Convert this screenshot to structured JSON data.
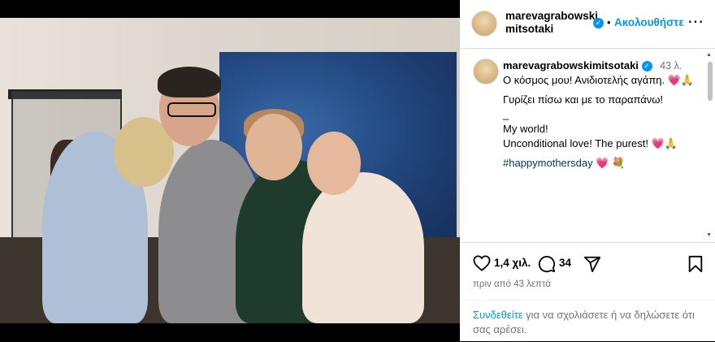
{
  "header": {
    "username": "marevagrabowskimitsotaki",
    "verified_mark": "✓",
    "separator": "•",
    "follow_label": "Ακολουθήστε",
    "more_label": "⋯"
  },
  "caption": {
    "username": "marevagrabowskimitsotaki",
    "verified_mark": "✓",
    "time": "43 λ.",
    "line1": "Ο κόσμος μου! Ανιδιοτελής αγάπη. 💗🙏",
    "line2": "Γυρίζει πίσω και με το παραπάνω!",
    "line3": "_",
    "line4": "My world!",
    "line5": "Unconditional love! The purest! 💗🙏",
    "hashtag": "#happymothersday",
    "hashtag_tail": "💗 💐"
  },
  "load_more_label": "+",
  "actions": {
    "likes": "1,4 χιλ.",
    "comments": "34",
    "posted_time": "πριν από 43 λεπτά"
  },
  "login": {
    "link": "Συνδεθείτε",
    "text": " για να σχολιάσετε ή να δηλώσετε ότι σας αρέσει."
  },
  "icons": {
    "heart": "heart-icon",
    "comment": "comment-icon",
    "share": "share-icon",
    "save": "bookmark-icon",
    "add": "plus-circle-icon",
    "more": "more-icon"
  },
  "colors": {
    "accent": "#0095f6",
    "secondary_text": "#737373",
    "hashtag": "#00376b"
  }
}
